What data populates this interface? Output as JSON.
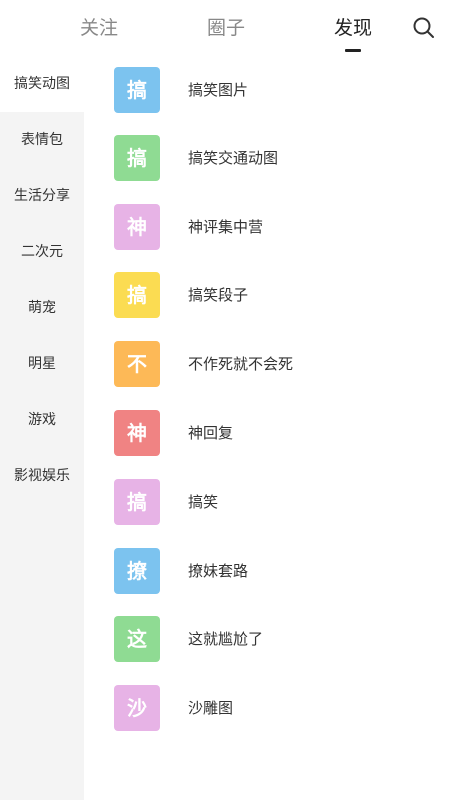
{
  "header": {
    "tabs": [
      {
        "label": "关注",
        "active": false
      },
      {
        "label": "圈子",
        "active": false
      },
      {
        "label": "发现",
        "active": true
      }
    ],
    "search_icon": "search-icon"
  },
  "sidebar": {
    "items": [
      {
        "label": "搞笑动图",
        "active": true
      },
      {
        "label": "表情包",
        "active": false
      },
      {
        "label": "生活分享",
        "active": false
      },
      {
        "label": "二次元",
        "active": false
      },
      {
        "label": "萌宠",
        "active": false
      },
      {
        "label": "明星",
        "active": false
      },
      {
        "label": "游戏",
        "active": false
      },
      {
        "label": "影视娱乐",
        "active": false
      }
    ]
  },
  "main": {
    "items": [
      {
        "avatar_text": "搞",
        "avatar_color": "#7cc3ef",
        "label": "搞笑图片"
      },
      {
        "avatar_text": "搞",
        "avatar_color": "#8fdb93",
        "label": "搞笑交通动图"
      },
      {
        "avatar_text": "神",
        "avatar_color": "#e7b3e6",
        "label": "神评集中营"
      },
      {
        "avatar_text": "搞",
        "avatar_color": "#fbdc52",
        "label": "搞笑段子"
      },
      {
        "avatar_text": "不",
        "avatar_color": "#fdb957",
        "label": "不作死就不会死"
      },
      {
        "avatar_text": "神",
        "avatar_color": "#f08383",
        "label": "神回复"
      },
      {
        "avatar_text": "搞",
        "avatar_color": "#e7b3e6",
        "label": "搞笑"
      },
      {
        "avatar_text": "撩",
        "avatar_color": "#7cc3ef",
        "label": "撩妹套路"
      },
      {
        "avatar_text": "这",
        "avatar_color": "#8fdb93",
        "label": "这就尴尬了"
      },
      {
        "avatar_text": "沙",
        "avatar_color": "#e7b3e6",
        "label": "沙雕图"
      }
    ]
  }
}
